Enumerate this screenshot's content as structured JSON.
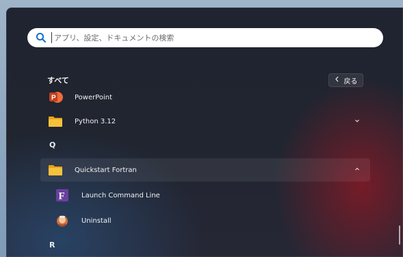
{
  "search": {
    "placeholder": "アプリ、設定、ドキュメントの検索"
  },
  "header": {
    "title": "すべて",
    "back_label": "戻る"
  },
  "apps": [
    {
      "label": "PowerPoint",
      "icon": "powerpoint-icon"
    },
    {
      "label": "Python 3.12",
      "icon": "folder-icon",
      "chevron": "down"
    }
  ],
  "letters": {
    "q": "Q",
    "r": "R"
  },
  "folder_open": {
    "label": "Quickstart Fortran",
    "icon": "folder-icon",
    "chevron": "up",
    "children": [
      {
        "label": "Launch Command Line",
        "icon": "fortran-icon"
      },
      {
        "label": "Uninstall",
        "icon": "uninstall-icon"
      }
    ]
  },
  "colors": {
    "folder": "#f0b322",
    "search_accent": "#1a6fcc",
    "fortran": "#6b3fa0",
    "powerpoint": "#c43e1c"
  }
}
